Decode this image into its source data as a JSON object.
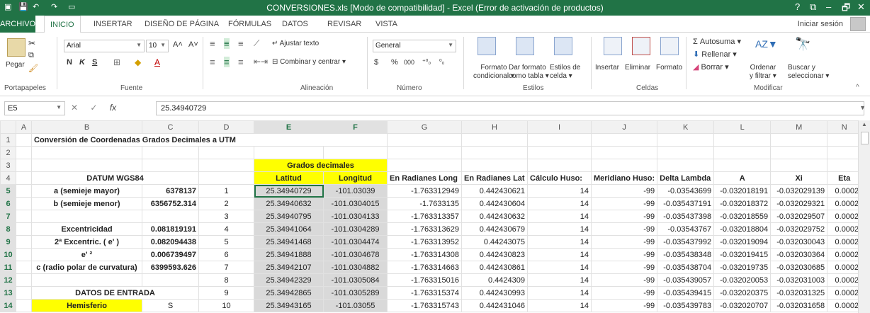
{
  "window": {
    "title": "CONVERSIONES.xls  [Modo de compatibilidad] - Excel (Error de activación de productos)",
    "help": "?",
    "controls": [
      "⧉",
      "–",
      "🗗",
      "✕"
    ]
  },
  "tabs": [
    "ARCHIVO",
    "INICIO",
    "INSERTAR",
    "DISEÑO DE PÁGINA",
    "FÓRMULAS",
    "DATOS",
    "REVISAR",
    "VISTA"
  ],
  "active_tab": "INICIO",
  "signin": "Iniciar sesión",
  "ribbon": {
    "clipboard": {
      "paste": "Pegar",
      "label": "Portapapeles"
    },
    "font": {
      "name": "Arial",
      "size": "10",
      "label": "Fuente",
      "bold": "N",
      "italic": "K",
      "underline": "S"
    },
    "alignment": {
      "wrap": "Ajustar texto",
      "merge": "Combinar y centrar",
      "label": "Alineación"
    },
    "number": {
      "format": "General",
      "currency": "$",
      "percent": "%",
      "thousands": "000",
      "label": "Número"
    },
    "styles": {
      "conditional": [
        "Formato",
        "condicional"
      ],
      "as_table": [
        "Dar formato",
        "como tabla"
      ],
      "cell_styles": [
        "Estilos de",
        "celda"
      ],
      "label": "Estilos"
    },
    "cells": {
      "insert": "Insertar",
      "delete": "Eliminar",
      "format": "Formato",
      "label": "Celdas"
    },
    "editing": {
      "autosum": "Autosuma",
      "fill": "Rellenar",
      "clear": "Borrar",
      "sort": [
        "Ordenar",
        "y filtrar"
      ],
      "find": [
        "Buscar y",
        "seleccionar"
      ],
      "label": "Modificar"
    }
  },
  "formula_bar": {
    "cell_ref": "E5",
    "fx": "fx",
    "value": "25.34940729"
  },
  "columns": [
    "A",
    "B",
    "C",
    "D",
    "E",
    "F",
    "G",
    "H",
    "I",
    "J",
    "K",
    "L",
    "M",
    "N"
  ],
  "selected_columns": [
    "E",
    "F"
  ],
  "sheet": {
    "title": "Conversión de Coordenadas Grados Decimales a UTM",
    "datum_header": "DATUM WGS84",
    "grados_header": "Grados decimales",
    "lat_header": "Latitud",
    "lon_header": "Longitud",
    "headers_g_n": [
      "En Radianes Long",
      "En Radianes Lat",
      "Cálculo Huso:",
      "Meridiano Huso:",
      "Delta Lambda",
      "A",
      "Xi",
      "Eta"
    ],
    "params": [
      {
        "label": "a (semieje mayor)",
        "value": "6378137"
      },
      {
        "label": "b (semieje menor)",
        "value": "6356752.314"
      },
      {
        "label": "",
        "value": ""
      },
      {
        "label": "Excentricidad",
        "value": "0.081819191"
      },
      {
        "label": "2ª Excentric. ( e' )",
        "value": "0.082094438"
      },
      {
        "label": "e' ²",
        "value": "0.006739497"
      },
      {
        "label": "c (radio polar de curvatura)",
        "value": "6399593.626"
      },
      {
        "label": "",
        "value": ""
      },
      {
        "label": "DATOS DE ENTRADA",
        "value": ""
      },
      {
        "label": "Hemisferio",
        "value": "S"
      }
    ],
    "rows": [
      [
        "1",
        "25.34940729",
        "-101.03039",
        "-1.763312949",
        "0.442430621",
        "14",
        "-99",
        "-0.03543699",
        "-0.032018191",
        "-0.032029139",
        "0.0002"
      ],
      [
        "2",
        "25.34940632",
        "-101.0304015",
        "-1.7633135",
        "0.442430604",
        "14",
        "-99",
        "-0.035437191",
        "-0.032018372",
        "-0.032029321",
        "0.0002"
      ],
      [
        "3",
        "25.34940795",
        "-101.0304133",
        "-1.763313357",
        "0.442430632",
        "14",
        "-99",
        "-0.035437398",
        "-0.032018559",
        "-0.032029507",
        "0.0002"
      ],
      [
        "4",
        "25.34941064",
        "-101.0304289",
        "-1.763313629",
        "0.442430679",
        "14",
        "-99",
        "-0.03543767",
        "-0.032018804",
        "-0.032029752",
        "0.0002"
      ],
      [
        "5",
        "25.34941468",
        "-101.0304474",
        "-1.763313952",
        "0.44243075",
        "14",
        "-99",
        "-0.035437992",
        "-0.032019094",
        "-0.032030043",
        "0.0002"
      ],
      [
        "6",
        "25.34941888",
        "-101.0304678",
        "-1.763314308",
        "0.442430823",
        "14",
        "-99",
        "-0.035438348",
        "-0.032019415",
        "-0.032030364",
        "0.0002"
      ],
      [
        "7",
        "25.34942107",
        "-101.0304882",
        "-1.763314663",
        "0.442430861",
        "14",
        "-99",
        "-0.035438704",
        "-0.032019735",
        "-0.032030685",
        "0.0002"
      ],
      [
        "8",
        "25.34942329",
        "-101.0305084",
        "-1.763315016",
        "0.4424309",
        "14",
        "-99",
        "-0.035439057",
        "-0.032020053",
        "-0.032031003",
        "0.0002"
      ],
      [
        "9",
        "25.34942865",
        "-101.0305289",
        "-1.763315374",
        "0.442430993",
        "14",
        "-99",
        "-0.035439415",
        "-0.032020375",
        "-0.032031325",
        "0.0002"
      ],
      [
        "10",
        "25.34943165",
        "-101.03055",
        "-1.763315743",
        "0.442431046",
        "14",
        "-99",
        "-0.035439783",
        "-0.032020707",
        "-0.032031658",
        "0.0002"
      ]
    ]
  }
}
